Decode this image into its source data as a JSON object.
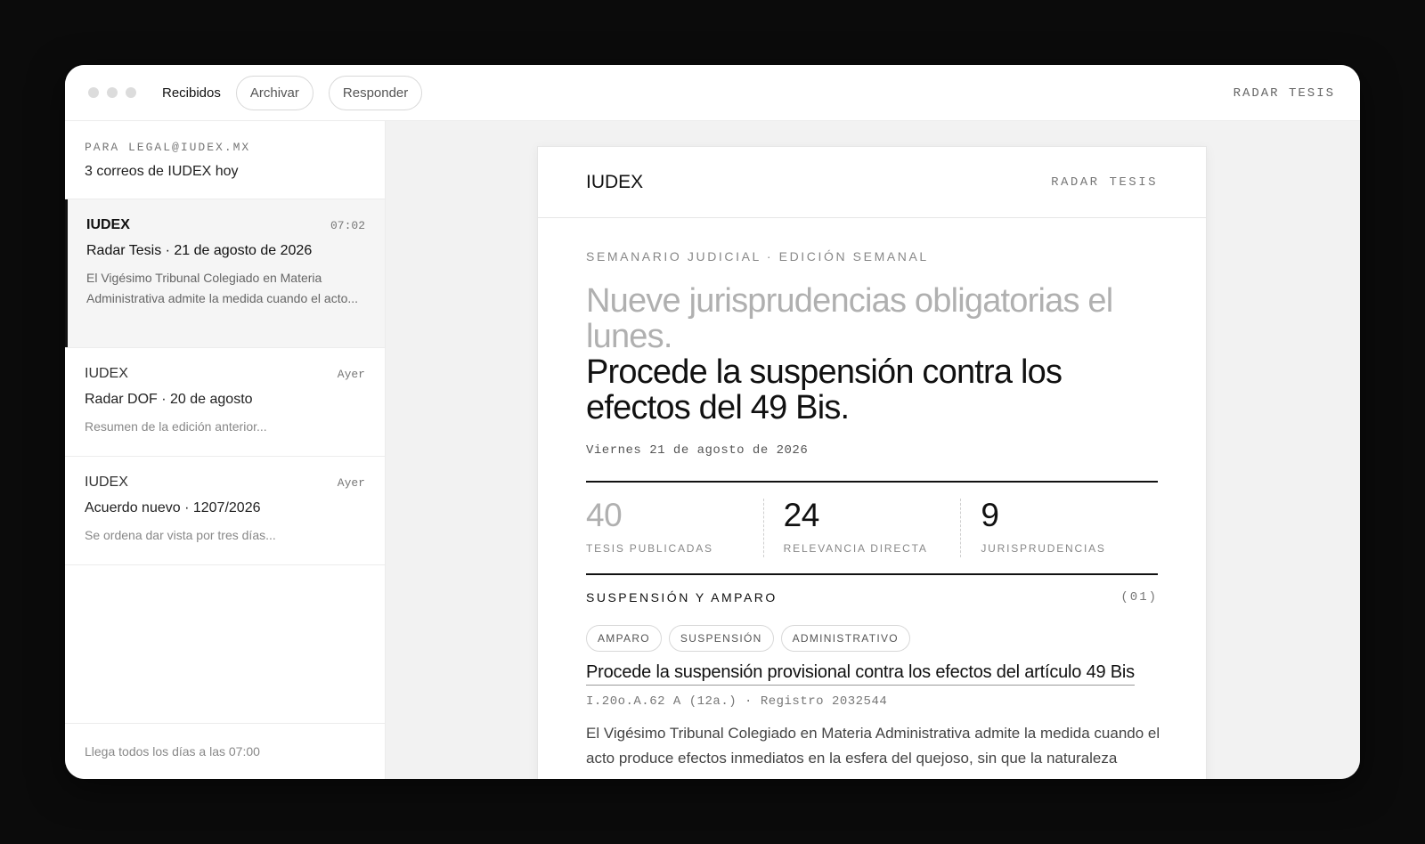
{
  "toolbar": {
    "inbox_label": "Recibidos",
    "archive_label": "Archivar",
    "reply_label": "Responder",
    "app_name": "RADAR TESIS"
  },
  "sidebar": {
    "recipient": "PARA LEGAL@IUDEX.MX",
    "count": "3 correos de IUDEX hoy",
    "messages": [
      {
        "from": "IUDEX",
        "time": "07:02",
        "subject": "Radar Tesis · 21 de agosto de 2026",
        "preview": "El Vigésimo Tribunal Colegiado en Materia Administrativa admite la medida cuando el acto..."
      },
      {
        "from": "IUDEX",
        "time": "Ayer",
        "subject": "Radar DOF · 20 de agosto",
        "preview": "Resumen de la edición anterior..."
      },
      {
        "from": "IUDEX",
        "time": "Ayer",
        "subject": "Acuerdo nuevo · 1207/2026",
        "preview": "Se ordena dar vista por tres días..."
      }
    ],
    "footer": "Llega todos los días a las 07:00"
  },
  "email": {
    "brand": "IUDEX",
    "tag": "RADAR TESIS",
    "kicker": "SEMANARIO JUDICIAL · EDICIÓN SEMANAL",
    "headline_muted": "Nueve jurisprudencias obligatorias el lunes.",
    "headline_strong": "Procede la suspensión contra los efectos del 49 Bis.",
    "date": "Viernes 21 de agosto de 2026",
    "stats": [
      {
        "value": "40",
        "label": "TESIS PUBLICADAS"
      },
      {
        "value": "24",
        "label": "RELEVANCIA DIRECTA"
      },
      {
        "value": "9",
        "label": "JURISPRUDENCIAS"
      }
    ],
    "section": {
      "title": "SUSPENSIÓN Y AMPARO",
      "number": "(01)",
      "tags": [
        "AMPARO",
        "SUSPENSIÓN",
        "ADMINISTRATIVO"
      ],
      "thesis_title": "Procede la suspensión provisional contra los efectos del artículo 49 Bis",
      "thesis_meta": "I.20o.A.62 A (12a.) · Registro 2032544",
      "thesis_text": "El Vigésimo Tribunal Colegiado en Materia Administrativa admite la medida cuando el acto produce efectos inmediatos en la esfera del quejoso, sin que la naturaleza"
    }
  }
}
